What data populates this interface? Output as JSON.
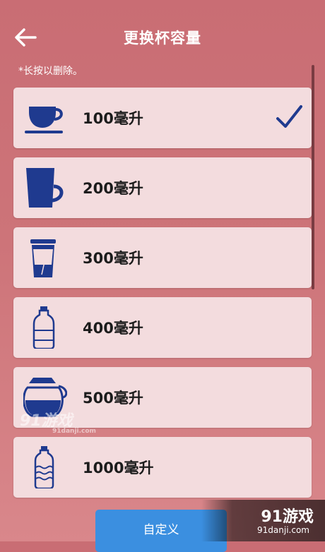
{
  "header": {
    "title": "更换杯容量",
    "back_icon": "arrow-left-icon"
  },
  "hint": "*长按以删除。",
  "items": [
    {
      "label": "100毫升",
      "icon": "coffee-cup-icon",
      "selected": true
    },
    {
      "label": "200毫升",
      "icon": "mug-icon",
      "selected": false
    },
    {
      "label": "300毫升",
      "icon": "takeaway-cup-icon",
      "selected": false
    },
    {
      "label": "400毫升",
      "icon": "small-bottle-icon",
      "selected": false
    },
    {
      "label": "500毫升",
      "icon": "coffee-pot-icon",
      "selected": false
    },
    {
      "label": "1000毫升",
      "icon": "water-bottle-icon",
      "selected": false
    }
  ],
  "custom_button": {
    "label": "自定义"
  },
  "watermark": {
    "text": "91游戏",
    "sub": "91danji.com"
  },
  "corner_logo": {
    "brand": "91游戏",
    "domain": "91danji.com"
  },
  "colors": {
    "accent": "#1f3a8f",
    "button": "#3b8fe0",
    "card": "#f3dcde"
  }
}
